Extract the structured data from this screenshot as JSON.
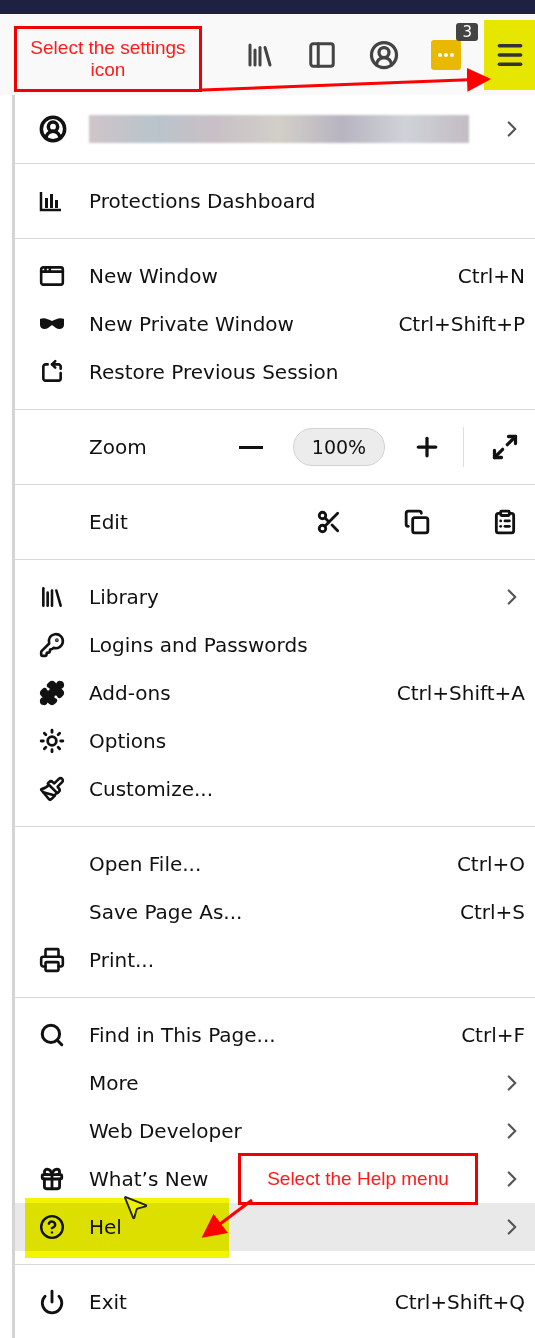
{
  "toolbar": {
    "buttons": [
      {
        "highlighted": false
      },
      {
        "highlighted": false
      },
      {
        "highlighted": false
      },
      {
        "badge": "3",
        "highlighted": false
      },
      {
        "highlighted": true
      }
    ]
  },
  "menu": {
    "sections": [
      {
        "kind": "account",
        "submenu": true
      },
      {
        "kind": "items",
        "items": [
          {
            "label": "Protections Dashboard",
            "submenu": false,
            "highlighted": false,
            "marked": false
          }
        ]
      },
      {
        "kind": "items",
        "items": [
          {
            "label": "New Window",
            "shortcut": "Ctrl+N",
            "submenu": false,
            "highlighted": false,
            "marked": false
          },
          {
            "label": "New Private Window",
            "shortcut": "Ctrl+Shift+P",
            "submenu": false,
            "highlighted": false,
            "marked": false
          },
          {
            "label": "Restore Previous Session",
            "submenu": false,
            "highlighted": false,
            "marked": false
          }
        ]
      },
      {
        "kind": "zoom",
        "label": "Zoom",
        "value": "100%"
      },
      {
        "kind": "edit",
        "label": "Edit"
      },
      {
        "kind": "items",
        "items": [
          {
            "label": "Library",
            "submenu": true,
            "highlighted": false,
            "marked": false
          },
          {
            "label": "Logins and Passwords",
            "submenu": false,
            "highlighted": false,
            "marked": false
          },
          {
            "label": "Add-ons",
            "shortcut": "Ctrl+Shift+A",
            "submenu": false,
            "highlighted": false,
            "marked": false
          },
          {
            "label": "Options",
            "submenu": false,
            "highlighted": false,
            "marked": false
          },
          {
            "label": "Customize...",
            "submenu": false,
            "highlighted": false,
            "marked": false
          }
        ]
      },
      {
        "kind": "items",
        "items": [
          {
            "label": "Open File...",
            "shortcut": "Ctrl+O",
            "submenu": false,
            "highlighted": false,
            "marked": false
          },
          {
            "label": "Save Page As...",
            "shortcut": "Ctrl+S",
            "submenu": false,
            "highlighted": false,
            "marked": false
          },
          {
            "label": "Print...",
            "submenu": false,
            "highlighted": false,
            "marked": false
          }
        ]
      },
      {
        "kind": "items",
        "items": [
          {
            "label": "Find in This Page...",
            "shortcut": "Ctrl+F",
            "submenu": false,
            "highlighted": false,
            "marked": false
          },
          {
            "label": "More",
            "submenu": true,
            "highlighted": false,
            "marked": false
          },
          {
            "label": "Web Developer",
            "submenu": true,
            "highlighted": false,
            "marked": false
          },
          {
            "label": "What’s New",
            "submenu": true,
            "highlighted": false,
            "marked": false
          },
          {
            "label": "Hel",
            "submenu": true,
            "highlighted": true,
            "marked": true
          }
        ]
      },
      {
        "kind": "items",
        "items": [
          {
            "label": "Exit",
            "shortcut": "Ctrl+Shift+Q",
            "submenu": false,
            "highlighted": false,
            "marked": false
          }
        ]
      }
    ]
  },
  "annotations": [
    {
      "text": "Select the settings icon"
    },
    {
      "text": "Select the Help menu"
    }
  ]
}
